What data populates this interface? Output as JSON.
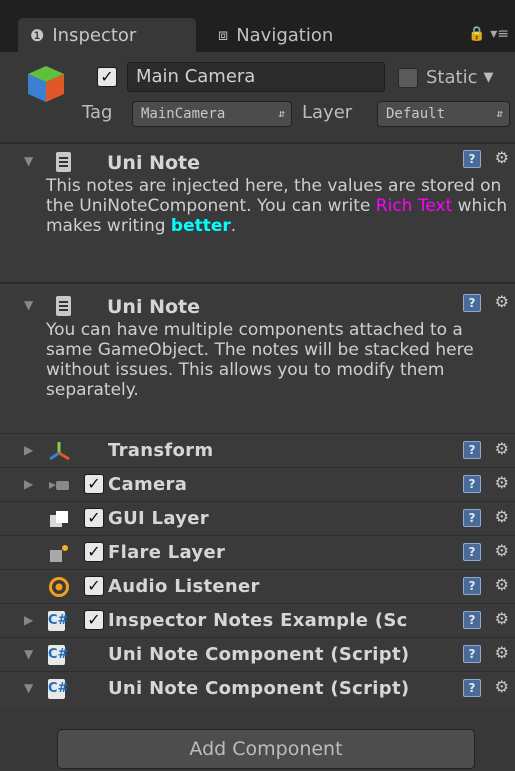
{
  "tabs": [
    {
      "label": "Inspector",
      "icon": "info-icon"
    },
    {
      "label": "Navigation",
      "icon": "navigation-icon"
    }
  ],
  "header": {
    "name": "Main Camera",
    "active": true,
    "static_label": "Static",
    "static": false,
    "tag_label": "Tag",
    "tag_value": "MainCamera",
    "layer_label": "Layer",
    "layer_value": "Default"
  },
  "notes": [
    {
      "title": "Uni Note",
      "text_before": "This notes are injected here, the values are stored on the UniNoteComponent. You can write ",
      "rich_text": "Rich Text",
      "text_middle": " which makes writing ",
      "bold_text": "better",
      "text_after": "."
    },
    {
      "title": "Uni Note",
      "text": "You can have multiple components attached to a same GameObject. The notes will be stacked here without issues. This allows you to modify them separately."
    }
  ],
  "components": [
    {
      "title": "Transform",
      "icon": "transform-icon",
      "has_checkbox": false,
      "foldout": "collapsed"
    },
    {
      "title": "Camera",
      "icon": "camera-icon",
      "has_checkbox": true,
      "foldout": "collapsed"
    },
    {
      "title": "GUI Layer",
      "icon": "gui-layer-icon",
      "has_checkbox": true,
      "foldout": "none"
    },
    {
      "title": "Flare Layer",
      "icon": "flare-layer-icon",
      "has_checkbox": true,
      "foldout": "none"
    },
    {
      "title": "Audio Listener",
      "icon": "audio-listener-icon",
      "has_checkbox": true,
      "foldout": "none"
    },
    {
      "title": "Inspector Notes Example (Sc",
      "icon": "script-icon",
      "has_checkbox": true,
      "foldout": "collapsed"
    },
    {
      "title": "Uni Note Component (Script)",
      "icon": "script-icon",
      "has_checkbox": false,
      "foldout": "expanded"
    },
    {
      "title": "Uni Note Component (Script)",
      "icon": "script-icon",
      "has_checkbox": false,
      "foldout": "expanded"
    }
  ],
  "add_component_label": "Add Component",
  "colors": {
    "rich_text": "#ff00ff",
    "bold_text": "#00ffff"
  }
}
